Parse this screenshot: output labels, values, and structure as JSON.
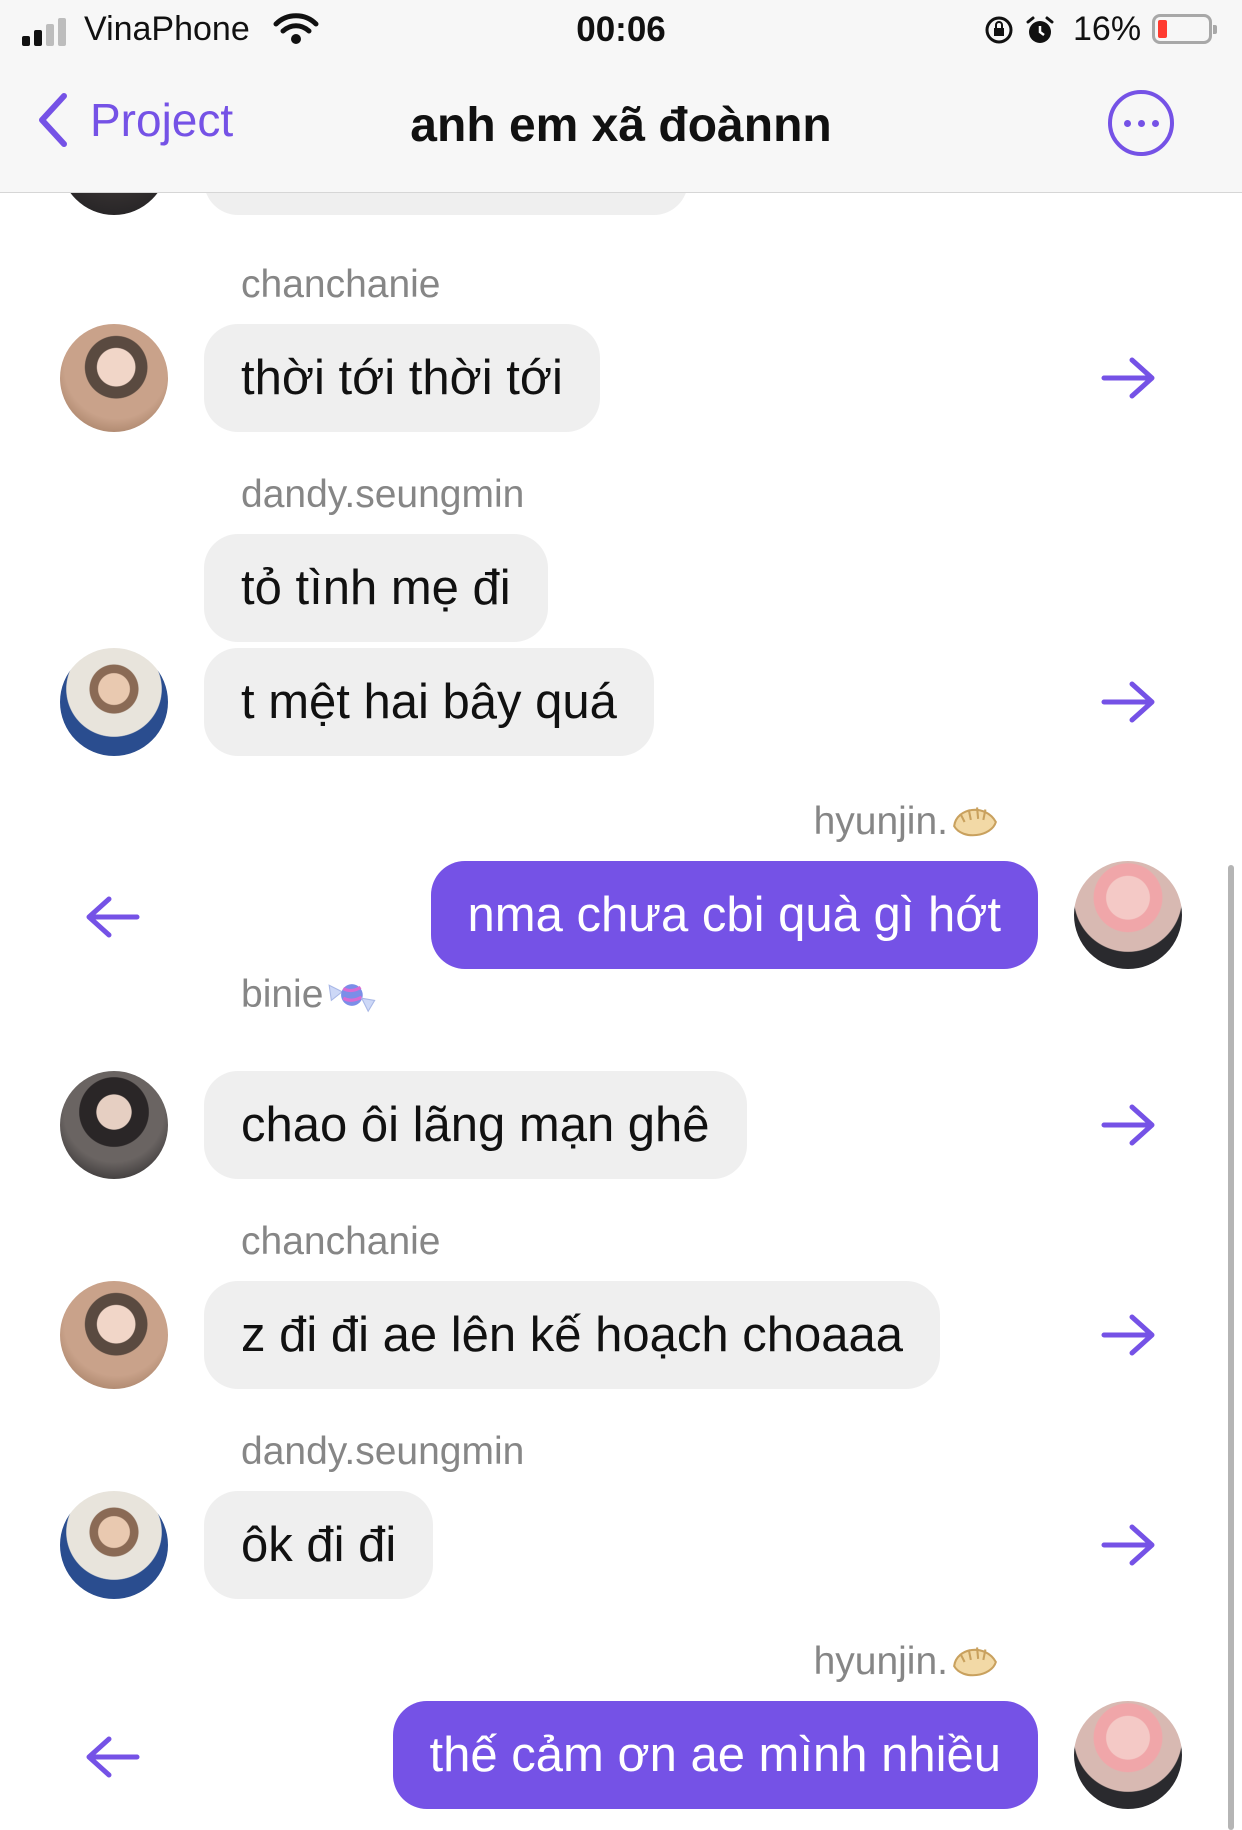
{
  "status": {
    "carrier": "VinaPhone",
    "time": "00:06",
    "battery": "16%"
  },
  "nav": {
    "back_label": "Project",
    "title": "anh em xã đoànnn"
  },
  "colors": {
    "accent": "#7552e6",
    "incoming_bubble": "#efefef",
    "battery_low": "#ff3b30"
  },
  "messages": [
    {
      "sender": "chanchanie",
      "text": "thời tới thời tới",
      "direction": "incoming",
      "action_icon": "forward-arrow-icon"
    },
    {
      "sender": "dandy.seungmin",
      "text": "tỏ tình mẹ đi",
      "direction": "incoming"
    },
    {
      "sender": "dandy.seungmin",
      "text": "t mệt hai bây quá",
      "direction": "incoming",
      "action_icon": "forward-arrow-icon"
    },
    {
      "sender": "hyunjin.",
      "sender_emoji": "dumpling-emoji",
      "text": "nma chưa cbi quà gì hớt",
      "direction": "outgoing",
      "action_icon": "back-arrow-icon"
    },
    {
      "sender": "binie",
      "sender_emoji": "candy-emoji",
      "text": "chao ôi lãng mạn ghê",
      "direction": "incoming",
      "action_icon": "forward-arrow-icon"
    },
    {
      "sender": "chanchanie",
      "text": "z đi đi ae lên kế hoạch choaaa",
      "direction": "incoming",
      "action_icon": "forward-arrow-icon"
    },
    {
      "sender": "dandy.seungmin",
      "text": "ôk đi đi",
      "direction": "incoming",
      "action_icon": "forward-arrow-icon"
    },
    {
      "sender": "hyunjin.",
      "sender_emoji": "dumpling-emoji",
      "text": "thế cảm ơn ae mình nhiều",
      "direction": "outgoing",
      "action_icon": "back-arrow-icon"
    }
  ]
}
